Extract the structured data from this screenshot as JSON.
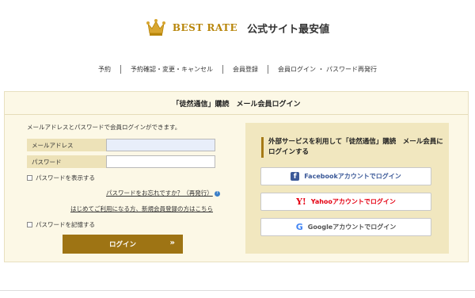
{
  "brand": {
    "best_rate": "BEST RATE",
    "subtitle": "公式サイト最安値",
    "crown_color": "#c9981e"
  },
  "nav": {
    "items": [
      {
        "label": "予約"
      },
      {
        "label": "予約確認・変更・キャンセル"
      },
      {
        "label": "会員登録"
      },
      {
        "label": "会員ログイン ・ パスワード再発行"
      }
    ]
  },
  "panel": {
    "title": "「徒然通信」購読　メール会員ログイン"
  },
  "login_form": {
    "description": "メールアドレスとパスワードで会員ログインができます。",
    "email_label": "メールアドレス",
    "email_value": "",
    "password_label": "パスワード",
    "password_value": "",
    "show_password_label": "パスワードを表示する",
    "forgot_password_link": "パスワードをお忘れですか？（再発行）",
    "register_link": "はじめてご利用になる方、新規会員登録の方はこちら",
    "remember_password_label": "パスワードを記憶する",
    "login_button_label": "ログイン",
    "login_button_arrow": "»",
    "accent_color": "#9e7414"
  },
  "social": {
    "title": "外部サービスを利用して「徒然通信」購読　メール会員にログインする",
    "buttons": [
      {
        "label": "Facebookアカウントでログイン",
        "icon": "facebook-icon",
        "glyph": "f",
        "color": "#3b5998"
      },
      {
        "label": "Yahooアカウントでログイン",
        "icon": "yahoo-icon",
        "glyph": "Y!",
        "color": "#e50012"
      },
      {
        "label": "Googleアカウントでログイン",
        "icon": "google-icon",
        "glyph": "G",
        "color": "#4285f4"
      }
    ]
  }
}
